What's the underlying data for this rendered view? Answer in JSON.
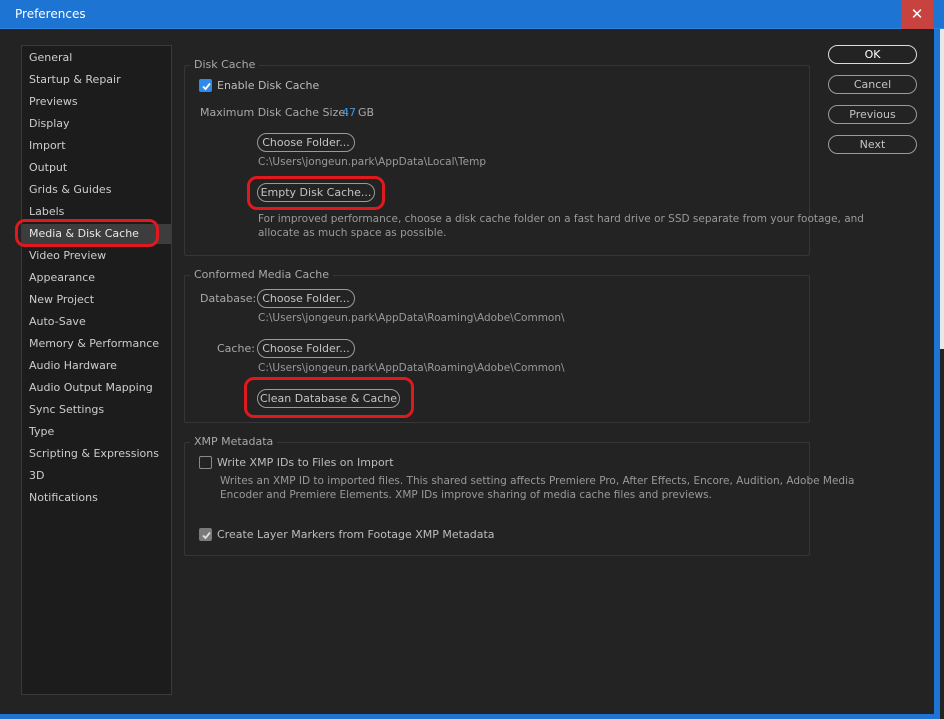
{
  "window": {
    "title": "Preferences",
    "close_glyph": "✕"
  },
  "sidebar": {
    "items": [
      {
        "label": "General"
      },
      {
        "label": "Startup & Repair"
      },
      {
        "label": "Previews"
      },
      {
        "label": "Display"
      },
      {
        "label": "Import"
      },
      {
        "label": "Output"
      },
      {
        "label": "Grids & Guides"
      },
      {
        "label": "Labels"
      },
      {
        "label": "Media & Disk Cache",
        "selected": true
      },
      {
        "label": "Video Preview"
      },
      {
        "label": "Appearance"
      },
      {
        "label": "New Project"
      },
      {
        "label": "Auto-Save"
      },
      {
        "label": "Memory & Performance"
      },
      {
        "label": "Audio Hardware"
      },
      {
        "label": "Audio Output Mapping"
      },
      {
        "label": "Sync Settings"
      },
      {
        "label": "Type"
      },
      {
        "label": "Scripting & Expressions"
      },
      {
        "label": "3D"
      },
      {
        "label": "Notifications"
      }
    ]
  },
  "disk_cache": {
    "title": "Disk Cache",
    "enable_label": "Enable Disk Cache",
    "enable_checked": true,
    "max_size_label": "Maximum Disk Cache Size:",
    "max_size_value": "47",
    "max_size_unit": "GB",
    "choose_folder": "Choose Folder...",
    "path": "C:\\Users\\jongeun.park\\AppData\\Local\\Temp",
    "empty_button": "Empty Disk Cache...",
    "note_line1": "For improved performance, choose a disk cache folder on a fast hard drive or SSD separate from your footage, and",
    "note_line2": "allocate as much space as possible."
  },
  "conformed": {
    "title": "Conformed Media Cache",
    "database_label": "Database:",
    "database_button": "Choose Folder...",
    "database_path": "C:\\Users\\jongeun.park\\AppData\\Roaming\\Adobe\\Common\\",
    "cache_label": "Cache:",
    "cache_button": "Choose Folder...",
    "cache_path": "C:\\Users\\jongeun.park\\AppData\\Roaming\\Adobe\\Common\\",
    "clean_button": "Clean Database & Cache"
  },
  "xmp": {
    "title": "XMP Metadata",
    "write_label": "Write XMP IDs to Files on Import",
    "write_checked": false,
    "desc_line1": "Writes an XMP ID to imported files. This shared setting affects Premiere Pro, After Effects, Encore, Audition, Adobe Media",
    "desc_line2": "Encoder and Premiere Elements. XMP IDs improve sharing of media cache files and previews.",
    "markers_label": "Create Layer Markers from Footage XMP Metadata",
    "markers_checked": true
  },
  "buttons": {
    "ok": "OK",
    "cancel": "Cancel",
    "previous": "Previous",
    "next": "Next"
  },
  "colors": {
    "title_bar": "#1e74d2",
    "close_button": "#c84240",
    "accent_blue": "#3f9be8",
    "highlight_red": "#e0191f"
  }
}
